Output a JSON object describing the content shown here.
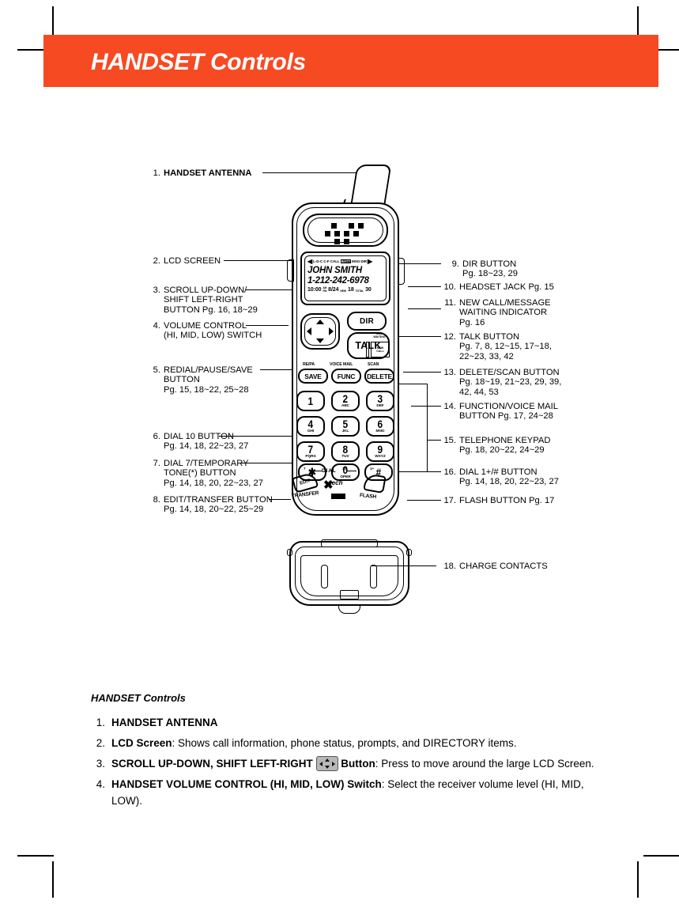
{
  "header": {
    "title": "HANDSET Controls",
    "band_color": "#F64A23"
  },
  "left_callouts": [
    {
      "num": "1.",
      "text": "HANDSET  ANTENNA",
      "bold": true
    },
    {
      "num": "2.",
      "text": "LCD SCREEN"
    },
    {
      "num": "3.",
      "text": "SCROLL UP-DOWN/\nSHIFT LEFT-RIGHT\nBUTTON Pg. 16, 18~29"
    },
    {
      "num": "4.",
      "text": "VOLUME CONTROL\n(HI, MID, LOW) SWITCH"
    },
    {
      "num": "5.",
      "text": "REDIAL/PAUSE/SAVE\nBUTTON\nPg. 15, 18~22, 25~28"
    },
    {
      "num": "6.",
      "text": "DIAL 10 BUTTON\nPg. 14, 18, 22~23, 27"
    },
    {
      "num": "7.",
      "text": "DIAL 7/TEMPORARY\nTONE(*) BUTTON\nPg. 14, 18, 20, 22~23, 27"
    },
    {
      "num": "8.",
      "text": "EDIT/TRANSFER BUTTON\nPg. 14, 18, 20~22, 25~29"
    }
  ],
  "right_callouts": [
    {
      "num": "9.",
      "text": "DIR BUTTON\nPg. 18~23, 29"
    },
    {
      "num": "10.",
      "text": "HEADSET JACK Pg. 15"
    },
    {
      "num": "11.",
      "text": "NEW CALL/MESSAGE\nWAITING INDICATOR\nPg. 16"
    },
    {
      "num": "12.",
      "text": "TALK BUTTON\nPg. 7, 8, 12~15, 17~18,\n22~23, 33, 42"
    },
    {
      "num": "13.",
      "text": "DELETE/SCAN BUTTON\nPg. 18~19, 21~23, 29, 39,\n42, 44, 53"
    },
    {
      "num": "14.",
      "text": "FUNCTION/VOICE MAIL\nBUTTON Pg. 17, 24~28"
    },
    {
      "num": "15.",
      "text": "TELEPHONE KEYPAD\nPg. 18, 20~22, 24~29"
    },
    {
      "num": "16.",
      "text": "DIAL 1+/# BUTTON\nPg. 14, 18, 20, 22~23, 27"
    },
    {
      "num": "17.",
      "text": "FLASH BUTTON Pg. 17"
    }
  ],
  "base_callout": {
    "num": "18.",
    "text": "CHARGE CONTACTS"
  },
  "handset": {
    "lcd": {
      "indicators": "L-D-C C-F CALL",
      "batt": "BATT",
      "msg": "MSG",
      "dir": "DIR",
      "arrow_left": "◀",
      "arrow_right": "▶",
      "caller_name": "JOHN SMITH",
      "caller_number": "1-212-242-6978",
      "time": "10:00",
      "ampm_top": "AM",
      "ampm_bottom": "PM",
      "date": "8/24",
      "new_label": "NEW",
      "new_count": "18",
      "total_label": "TOTAL",
      "total_count": "30"
    },
    "buttons": {
      "dir": "DIR",
      "talk": "TALK",
      "save": "SAVE",
      "save_top": "RE/PA",
      "func": "FUNC",
      "func_top": "VOICE MAIL",
      "delete": "DELETE",
      "delete_top": "SCAN",
      "transfer_face": "EDIT",
      "transfer": "TRANSFER",
      "flash": "FLASH",
      "dial": "DIAL",
      "msg_waiting": "MSG\nWAITING",
      "new_call": "NEW\nCALL",
      "brand": "tech"
    },
    "keypad": [
      {
        "digit": "1",
        "sub": ""
      },
      {
        "digit": "2",
        "sub": "ABC"
      },
      {
        "digit": "3",
        "sub": "DEF"
      },
      {
        "digit": "4",
        "sub": "GHI"
      },
      {
        "digit": "5",
        "sub": "JKL"
      },
      {
        "digit": "6",
        "sub": "MNO"
      },
      {
        "digit": "7",
        "sub": "PQRS"
      },
      {
        "digit": "8",
        "sub": "TUV"
      },
      {
        "digit": "9",
        "sub": "WXYZ"
      },
      {
        "digit": "✱",
        "sub": "",
        "sup": "7"
      },
      {
        "digit": "0",
        "sub": "OPER",
        "sup": "10"
      },
      {
        "digit": "#",
        "sub": "",
        "sup": "1+"
      }
    ]
  },
  "prose": {
    "heading": "HANDSET Controls",
    "items": [
      {
        "num": "1.",
        "lead": "HANDSET ANTENNA",
        "rest": ""
      },
      {
        "num": "2.",
        "lead": "LCD Screen",
        "rest": ": Shows call information, phone status, prompts, and DIRECTORY items."
      },
      {
        "num": "3.",
        "lead": "SCROLL UP-DOWN, SHIFT LEFT-RIGHT",
        "mid_bold": "Button",
        "rest": ": Press to move around the large LCD Screen."
      },
      {
        "num": "4.",
        "lead": "HANDSET VOLUME CONTROL (HI, MID, LOW) Switch",
        "rest": ": Select the receiver volume level (HI, MID, LOW)."
      }
    ]
  }
}
